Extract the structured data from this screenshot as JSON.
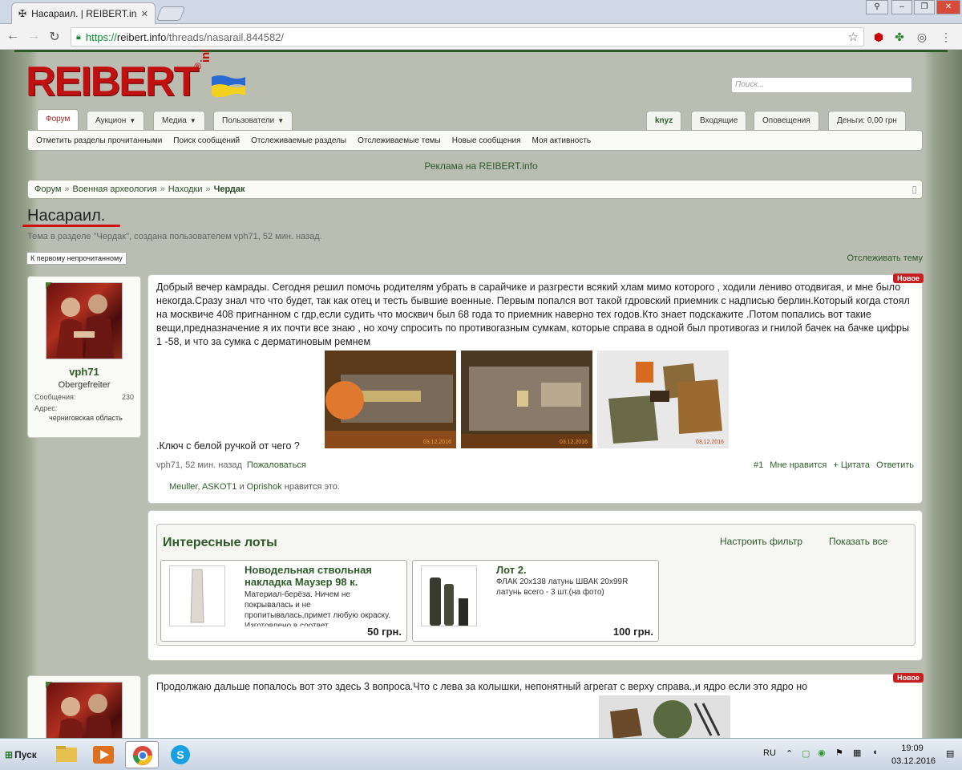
{
  "browser": {
    "tab_title": "Насараил. | REIBERT.info",
    "url_https": "https://",
    "url_host": "reibert.info",
    "url_path": "/threads/nasarail.844582/"
  },
  "site": {
    "logo_word": "REIBERT",
    "logo_info": "info",
    "logo_reg": "®",
    "search_placeholder": "Поиск..."
  },
  "nav": {
    "tabs": [
      {
        "label": "Форум"
      },
      {
        "label": "Аукцион"
      },
      {
        "label": "Медиа"
      },
      {
        "label": "Пользователи"
      }
    ],
    "right": [
      {
        "label": "knyz"
      },
      {
        "label": "Входящие"
      },
      {
        "label": "Оповещения"
      },
      {
        "label": "Деньги: 0,00 грн"
      }
    ],
    "sub": [
      "Отметить разделы прочитанными",
      "Поиск сообщений",
      "Отслеживаемые разделы",
      "Отслеживаемые темы",
      "Новые сообщения",
      "Моя активность"
    ]
  },
  "ad_text": "Реклама на REIBERT.info",
  "breadcrumb": [
    "Форум",
    "Военная археология",
    "Находки",
    "Чердак"
  ],
  "thread": {
    "title": "Насараил.",
    "meta": "Тема в разделе \"Чердак\", создана пользователем vph71, 52 мин. назад.",
    "first_unread": "К первому непрочитанному",
    "follow": "Отслеживать тему"
  },
  "user": {
    "name": "vph71",
    "title": "Obergefreiter",
    "posts_label": "Сообщения:",
    "posts_value": "230",
    "addr_label": "Адрес:",
    "addr_value": "черниговская область"
  },
  "post1": {
    "badge": "Новое",
    "text": "Добрый вечер камрады. Сегодня решил помочь родителям убрать в сарайчике и разгрести всякий хлам мимо которого , ходили лениво отодвигая, и мне было некогда.Сразу знал что что будет, так как отец и тесть бывшие военные. Первым попался вот такой гдровский приемник с надписью берлин.Который когда стоял на москвиче 408 пригнанном с гдр,если судить что москвич был 68 года то приемник наверно тех годов.Кто знает подскажите .Потом попались вот такие вещи,предназначение я их почти все знаю , но хочу спросить по противогазным сумкам, которые справа в одной был противогаз и гнилой бачек на бачке цифры 1 -58, и что за сумка с дерматиновым ремнем",
    "text_end": ".Ключ с белой ручкой от чего ?",
    "img_date": "03.12.2016",
    "meta": "vph71, 52 мин. назад",
    "report": "Пожаловаться",
    "num": "#1",
    "like": "Мне нравится",
    "quote": "+ Цитата",
    "reply": "Ответить",
    "likers": "Meuller, ASKOT1",
    "likers_and": "и",
    "likers_last": "Oprishok",
    "likers_suffix": "нравится это."
  },
  "lots": {
    "heading": "Интересные лоты",
    "filter": "Настроить фильтр",
    "show_all": "Показать все",
    "items": [
      {
        "title": "Новодельная ствольная накладка Маузер 98 к.",
        "desc": "Материал-берёза. Ничем не покрывалась и не пропитывалась,примет любую окраску. Изготовлено в соответ",
        "price": "50 грн."
      },
      {
        "title": "Лот 2.",
        "desc": "ФЛАК 20х138 латунь ШВАК 20х99R латунь всего - 3 шт.(на фото)",
        "price": "100 грн."
      }
    ]
  },
  "post2": {
    "badge": "Новое",
    "text": "Продолжаю дальше попалось вот это здесь 3 вопроса.Что с лева за колышки, непонятный агрегат с верху справа.,и ядро если это ядро но"
  },
  "taskbar": {
    "start": "Пуск",
    "lang": "RU",
    "time": "19:09",
    "date": "03.12.2016"
  }
}
